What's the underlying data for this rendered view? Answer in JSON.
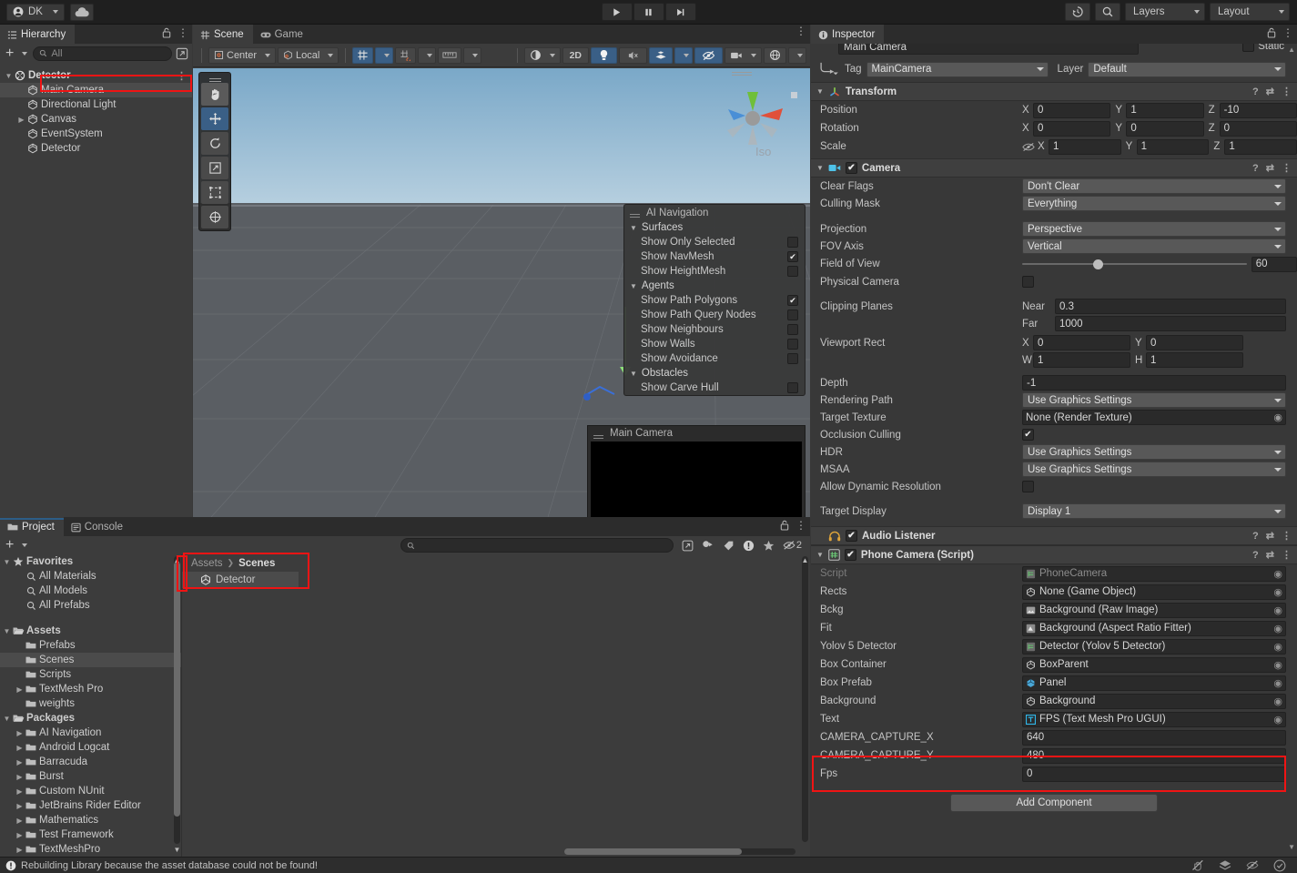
{
  "toolbar": {
    "account": "DK",
    "cloud_icon": "cloud-icon",
    "play": "play-icon",
    "pause": "pause-icon",
    "step": "step-icon",
    "history_icon": "undo-history-icon",
    "search_icon": "search-icon",
    "layers": "Layers",
    "layout": "Layout"
  },
  "hierarchy": {
    "tab": "Hierarchy",
    "search_placeholder": "All",
    "add_label": "+",
    "items": [
      {
        "label": "Detector",
        "depth": 0,
        "icon": "unity-scene-icon",
        "expanded": true,
        "selected": false,
        "root": true
      },
      {
        "label": "Main Camera",
        "depth": 1,
        "icon": "gameobject-icon",
        "expanded": null,
        "selected": true,
        "root": false
      },
      {
        "label": "Directional Light",
        "depth": 1,
        "icon": "gameobject-icon",
        "expanded": null,
        "selected": false,
        "root": false
      },
      {
        "label": "Canvas",
        "depth": 1,
        "icon": "gameobject-icon",
        "expanded": false,
        "selected": false,
        "root": false
      },
      {
        "label": "EventSystem",
        "depth": 1,
        "icon": "gameobject-icon",
        "expanded": null,
        "selected": false,
        "root": false
      },
      {
        "label": "Detector",
        "depth": 1,
        "icon": "gameobject-icon",
        "expanded": null,
        "selected": false,
        "root": false
      }
    ]
  },
  "scene": {
    "tab_scene": "Scene",
    "tab_game": "Game",
    "pivot": "Center",
    "handle": "Local",
    "two_d": "2D",
    "gizmo_label": "Iso",
    "tools": [
      "hand-tool",
      "move-tool",
      "rotate-tool",
      "scale-tool",
      "rect-tool",
      "transform-tool"
    ],
    "active_tool": "move-tool",
    "camera_preview_title": "Main Camera",
    "ai_nav": {
      "title": "AI Navigation",
      "groups": [
        {
          "name": "Surfaces",
          "rows": [
            {
              "label": "Show Only Selected",
              "checked": false
            },
            {
              "label": "Show NavMesh",
              "checked": true
            },
            {
              "label": "Show HeightMesh",
              "checked": false
            }
          ]
        },
        {
          "name": "Agents",
          "rows": [
            {
              "label": "Show Path Polygons",
              "checked": true
            },
            {
              "label": "Show Path Query Nodes",
              "checked": false
            },
            {
              "label": "Show Neighbours",
              "checked": false
            },
            {
              "label": "Show Walls",
              "checked": false
            },
            {
              "label": "Show Avoidance",
              "checked": false
            }
          ]
        },
        {
          "name": "Obstacles",
          "rows": [
            {
              "label": "Show Carve Hull",
              "checked": false
            }
          ]
        }
      ]
    }
  },
  "project": {
    "tab_project": "Project",
    "tab_console": "Console",
    "search_placeholder": "",
    "hidden_count": "2",
    "breadcrumb": [
      "Assets",
      "Scenes"
    ],
    "content_items": [
      {
        "label": "Detector",
        "icon": "unity-scene-icon"
      }
    ],
    "tree": [
      {
        "label": "Favorites",
        "depth": 0,
        "icon": "star-icon",
        "expanded": true,
        "bold": true,
        "selected": false
      },
      {
        "label": "All Materials",
        "depth": 1,
        "icon": "search-icon",
        "expanded": null,
        "bold": false,
        "selected": false
      },
      {
        "label": "All Models",
        "depth": 1,
        "icon": "search-icon",
        "expanded": null,
        "bold": false,
        "selected": false
      },
      {
        "label": "All Prefabs",
        "depth": 1,
        "icon": "search-icon",
        "expanded": null,
        "bold": false,
        "selected": false
      },
      {
        "label": "",
        "depth": 0,
        "icon": "spacer",
        "expanded": null,
        "bold": false,
        "selected": false
      },
      {
        "label": "Assets",
        "depth": 0,
        "icon": "folder-open-icon",
        "expanded": true,
        "bold": true,
        "selected": false
      },
      {
        "label": "Prefabs",
        "depth": 1,
        "icon": "folder-icon",
        "expanded": null,
        "bold": false,
        "selected": false
      },
      {
        "label": "Scenes",
        "depth": 1,
        "icon": "folder-icon",
        "expanded": null,
        "bold": false,
        "selected": true
      },
      {
        "label": "Scripts",
        "depth": 1,
        "icon": "folder-icon",
        "expanded": null,
        "bold": false,
        "selected": false
      },
      {
        "label": "TextMesh Pro",
        "depth": 1,
        "icon": "folder-icon",
        "expanded": false,
        "bold": false,
        "selected": false
      },
      {
        "label": "weights",
        "depth": 1,
        "icon": "folder-icon",
        "expanded": null,
        "bold": false,
        "selected": false
      },
      {
        "label": "Packages",
        "depth": 0,
        "icon": "folder-open-icon",
        "expanded": true,
        "bold": true,
        "selected": false
      },
      {
        "label": "AI Navigation",
        "depth": 1,
        "icon": "folder-icon",
        "expanded": false,
        "bold": false,
        "selected": false
      },
      {
        "label": "Android Logcat",
        "depth": 1,
        "icon": "folder-icon",
        "expanded": false,
        "bold": false,
        "selected": false
      },
      {
        "label": "Barracuda",
        "depth": 1,
        "icon": "folder-icon",
        "expanded": false,
        "bold": false,
        "selected": false
      },
      {
        "label": "Burst",
        "depth": 1,
        "icon": "folder-icon",
        "expanded": false,
        "bold": false,
        "selected": false
      },
      {
        "label": "Custom NUnit",
        "depth": 1,
        "icon": "folder-icon",
        "expanded": false,
        "bold": false,
        "selected": false
      },
      {
        "label": "JetBrains Rider Editor",
        "depth": 1,
        "icon": "folder-icon",
        "expanded": false,
        "bold": false,
        "selected": false
      },
      {
        "label": "Mathematics",
        "depth": 1,
        "icon": "folder-icon",
        "expanded": false,
        "bold": false,
        "selected": false
      },
      {
        "label": "Test Framework",
        "depth": 1,
        "icon": "folder-icon",
        "expanded": false,
        "bold": false,
        "selected": false
      },
      {
        "label": "TextMeshPro",
        "depth": 1,
        "icon": "folder-icon",
        "expanded": false,
        "bold": false,
        "selected": false
      }
    ]
  },
  "inspector": {
    "tab": "Inspector",
    "object_name": "Main Camera",
    "static_label": "Static",
    "tag_label": "Tag",
    "tag_value": "MainCamera",
    "layer_label": "Layer",
    "layer_value": "Default",
    "transform": {
      "title": "Transform",
      "position_label": "Position",
      "rotation_label": "Rotation",
      "scale_label": "Scale",
      "position": {
        "x": "0",
        "y": "1",
        "z": "-10"
      },
      "rotation": {
        "x": "0",
        "y": "0",
        "z": "0"
      },
      "scale": {
        "x": "1",
        "y": "1",
        "z": "1"
      }
    },
    "camera": {
      "title": "Camera",
      "enabled": true,
      "clear_flags_label": "Clear Flags",
      "clear_flags_value": "Don't Clear",
      "culling_mask_label": "Culling Mask",
      "culling_mask_value": "Everything",
      "projection_label": "Projection",
      "projection_value": "Perspective",
      "fov_axis_label": "FOV Axis",
      "fov_axis_value": "Vertical",
      "field_of_view_label": "Field of View",
      "field_of_view_value": "60",
      "physical_camera_label": "Physical Camera",
      "physical_camera_checked": false,
      "clipping_planes_label": "Clipping Planes",
      "near_label": "Near",
      "near_value": "0.3",
      "far_label": "Far",
      "far_value": "1000",
      "viewport_rect_label": "Viewport Rect",
      "viewport": {
        "x": "0",
        "y": "0",
        "w": "1",
        "h": "1"
      },
      "depth_label": "Depth",
      "depth_value": "-1",
      "rendering_path_label": "Rendering Path",
      "rendering_path_value": "Use Graphics Settings",
      "target_texture_label": "Target Texture",
      "target_texture_value": "None (Render Texture)",
      "occlusion_culling_label": "Occlusion Culling",
      "occlusion_culling_checked": true,
      "hdr_label": "HDR",
      "hdr_value": "Use Graphics Settings",
      "msaa_label": "MSAA",
      "msaa_value": "Use Graphics Settings",
      "allow_dynamic_resolution_label": "Allow Dynamic Resolution",
      "allow_dynamic_resolution_checked": false,
      "target_display_label": "Target Display",
      "target_display_value": "Display 1"
    },
    "audio_listener": {
      "title": "Audio Listener",
      "enabled": true
    },
    "phone_camera": {
      "title": "Phone Camera (Script)",
      "enabled": true,
      "fields": [
        {
          "label": "Script",
          "value": "PhoneCamera",
          "kind": "obj",
          "icon": "script-icon",
          "dim": true,
          "highlight": false
        },
        {
          "label": "Rects",
          "value": "None (Game Object)",
          "kind": "obj",
          "icon": "gameobject-icon",
          "dim": false,
          "highlight": false
        },
        {
          "label": "Bckg",
          "value": "Background (Raw Image)",
          "kind": "obj",
          "icon": "rawimage-icon",
          "dim": false,
          "highlight": false
        },
        {
          "label": "Fit",
          "value": "Background (Aspect Ratio Fitter)",
          "kind": "obj",
          "icon": "fitter-icon",
          "dim": false,
          "highlight": false
        },
        {
          "label": "Yolov 5 Detector",
          "value": "Detector (Yolov 5 Detector)",
          "kind": "obj",
          "icon": "script-icon",
          "dim": false,
          "highlight": false
        },
        {
          "label": "Box Container",
          "value": "BoxParent",
          "kind": "obj",
          "icon": "gameobject-icon",
          "dim": false,
          "highlight": false
        },
        {
          "label": "Box Prefab",
          "value": "Panel",
          "kind": "obj",
          "icon": "prefab-icon",
          "dim": false,
          "highlight": false
        },
        {
          "label": "Background",
          "value": "Background",
          "kind": "obj",
          "icon": "gameobject-icon",
          "dim": false,
          "highlight": false
        },
        {
          "label": "Text",
          "value": "FPS (Text Mesh Pro UGUI)",
          "kind": "obj",
          "icon": "tmp-icon",
          "dim": false,
          "highlight": false
        },
        {
          "label": "CAMERA_CAPTURE_X",
          "value": "640",
          "kind": "num",
          "icon": "",
          "dim": false,
          "highlight": true
        },
        {
          "label": "CAMERA_CAPTURE_Y",
          "value": "480",
          "kind": "num",
          "icon": "",
          "dim": false,
          "highlight": true
        },
        {
          "label": "Fps",
          "value": "0",
          "kind": "num",
          "icon": "",
          "dim": false,
          "highlight": false
        }
      ]
    },
    "add_component": "Add Component"
  },
  "status": {
    "message": "Rebuilding Library because the asset database could not be found!",
    "icons": [
      "no-bug-icon",
      "layers-stack-icon",
      "no-eye-icon",
      "check-circle-icon"
    ]
  },
  "colors": {
    "accent_blue": "#3a5f86",
    "highlight_red": "#f01414",
    "panel_bg": "#3c3c3c",
    "inspector_bg": "#383838"
  }
}
